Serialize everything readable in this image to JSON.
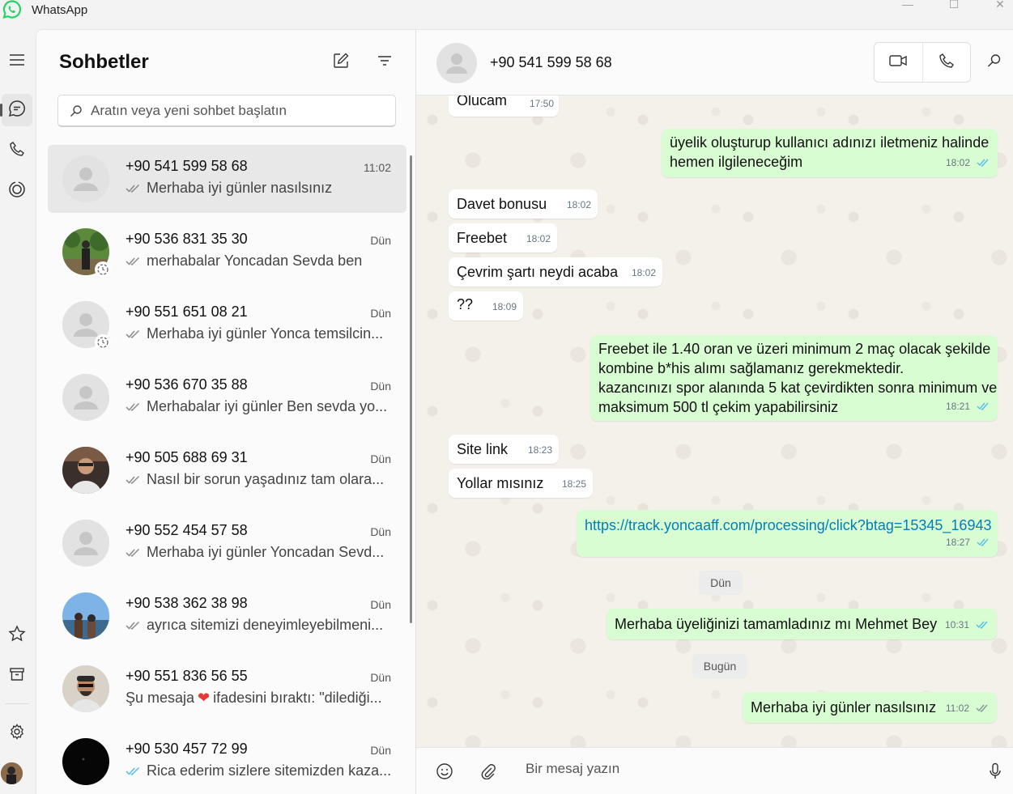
{
  "app": {
    "title": "WhatsApp",
    "brand_color": "#25d366"
  },
  "window_controls": {
    "minimize": "—",
    "maximize": "☐",
    "close": "✕"
  },
  "rail": {
    "items": [
      {
        "name": "menu-icon",
        "active": false
      },
      {
        "name": "chats-icon",
        "active": true
      },
      {
        "name": "calls-icon",
        "active": false
      },
      {
        "name": "status-icon",
        "active": false
      },
      {
        "name": "starred-icon",
        "active": false
      },
      {
        "name": "archive-icon",
        "active": false
      },
      {
        "name": "settings-icon",
        "active": false
      }
    ]
  },
  "chat_list": {
    "title": "Sohbetler",
    "search_placeholder": "Aratın veya yeni sohbet başlatın",
    "chats": [
      {
        "name": "+90 541 599 58 68",
        "time": "11:02",
        "preview": "Merhaba iyi günler nasılsınız",
        "tick": "read-gray",
        "avatar": "default",
        "status_ring": false,
        "selected": true
      },
      {
        "name": "+90 536 831 35 30",
        "time": "Dün",
        "preview": "merhabalar Yoncadan Sevda ben",
        "tick": "read-gray",
        "avatar": "photo-outdoor",
        "status_ring": true,
        "selected": false
      },
      {
        "name": "+90 551 651 08 21",
        "time": "Dün",
        "preview": "Merhaba iyi günler Yonca temsilcin...",
        "tick": "read-gray",
        "avatar": "default",
        "status_ring": true,
        "selected": false
      },
      {
        "name": "+90 536 670 35 88",
        "time": "Dün",
        "preview": "Merhabalar iyi günler Ben sevda yo...",
        "tick": "read-gray",
        "avatar": "default",
        "status_ring": false,
        "selected": false
      },
      {
        "name": "+90 505 688 69 31",
        "time": "Dün",
        "preview": "Nasıl bir sorun yaşadınız tam olara...",
        "tick": "read-gray",
        "avatar": "photo-man-dark",
        "status_ring": false,
        "selected": false
      },
      {
        "name": "+90 552 454 57 58",
        "time": "Dün",
        "preview": "Merhaba iyi günler  Yoncadan Sevd...",
        "tick": "read-gray",
        "avatar": "default",
        "status_ring": false,
        "selected": false
      },
      {
        "name": "+90 538 362 38 98",
        "time": "Dün",
        "preview": "ayrıca sitemizi deneyimleyebilmeni...",
        "tick": "read-gray",
        "avatar": "photo-sky",
        "status_ring": false,
        "selected": false
      },
      {
        "name": "+90 551 836 56 55",
        "time": "Dün",
        "preview_prefix": "Şu mesaja",
        "preview_emoji": "❤",
        "preview_suffix": "ifadesini bıraktı: \"dilediği...",
        "tick": "none",
        "avatar": "photo-man-cap",
        "status_ring": false,
        "selected": false
      },
      {
        "name": "+90 530 457 72 99",
        "time": "Dün",
        "preview": "Rica ederim sizlere sitemizden kaza...",
        "tick": "read-blue",
        "avatar": "photo-black",
        "status_ring": false,
        "selected": false
      }
    ]
  },
  "conversation": {
    "contact_name": "+90 541 599 58 68",
    "composer_placeholder": "Bir mesaj yazın",
    "colors": {
      "incoming": "#ffffff",
      "outgoing": "#d9fdd3",
      "read_tick": "#53bdeb",
      "link": "#027eb5"
    },
    "messages": [
      {
        "dir": "in",
        "text": "Olucam",
        "time": "17:50"
      },
      {
        "dir": "out",
        "line1": "üyelik oluşturup kullanıcı adınızı iletmeniz halinde",
        "line2": "hemen ilgileneceğim",
        "time": "18:02",
        "tick": "read-blue"
      },
      {
        "dir": "in",
        "text": "Davet bonusu",
        "time": "18:02"
      },
      {
        "dir": "in",
        "text": "Freebet",
        "time": "18:02"
      },
      {
        "dir": "in",
        "text": "Çevrim şartı neydi acaba",
        "time": "18:02"
      },
      {
        "dir": "in",
        "text": "??",
        "time": "18:09"
      },
      {
        "dir": "out",
        "line1": "Freebet ile 1.40 oran ve üzeri minimum 2 maç olacak şekilde",
        "line2": "kombine b*his alımı sağlamanız gerekmektedir.",
        "line3": "kazancınızı spor alanında 5 kat çevirdikten sonra minimum ve",
        "line4": "maksimum 500 tl çekim yapabilirsiniz",
        "time": "18:21",
        "tick": "read-blue"
      },
      {
        "dir": "in",
        "text": "Site link",
        "time": "18:23"
      },
      {
        "dir": "in",
        "text": "Yollar mısınız",
        "time": "18:25"
      },
      {
        "dir": "out",
        "link": "https://track.yoncaaff.com/processing/click?btag=15345_16943",
        "time": "18:27",
        "tick": "read-blue"
      },
      {
        "dir": "out",
        "text": "Merhaba üyeliğinizi tamamladınız mı Mehmet Bey",
        "time": "10:31",
        "tick": "read-blue"
      },
      {
        "dir": "out",
        "text": "Merhaba iyi günler nasılsınız",
        "time": "11:02",
        "tick": "read-gray"
      }
    ],
    "date_chips": {
      "yesterday": "Dün",
      "today": "Bugün"
    }
  }
}
